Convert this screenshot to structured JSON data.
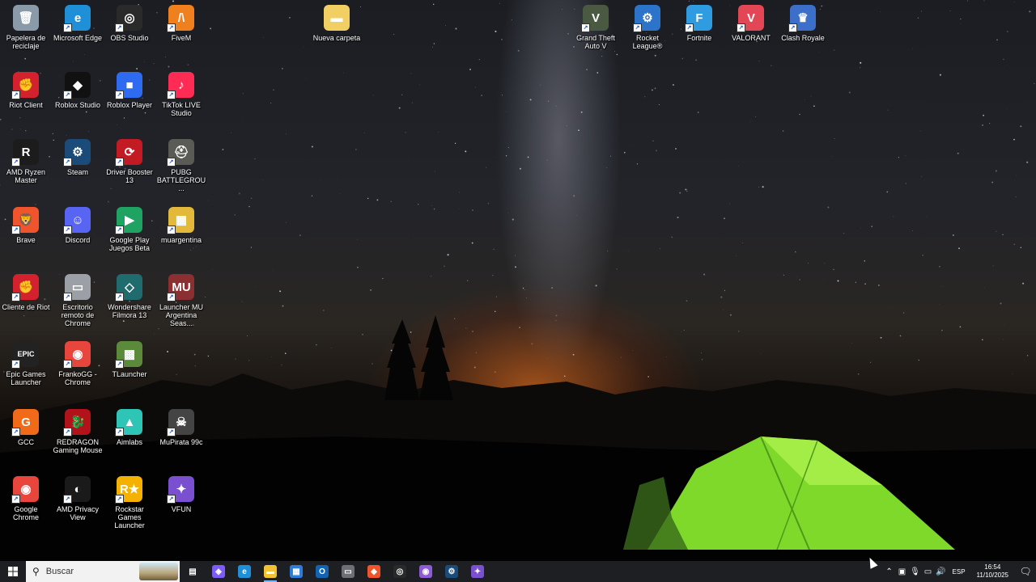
{
  "desktop": {
    "icons": [
      {
        "label": "Papelera de reciclaje",
        "glyph": "🗑",
        "color": "#8a9aa8",
        "shortcut": false
      },
      {
        "label": "Microsoft Edge",
        "glyph": "e",
        "color": "#1f8fd8",
        "shortcut": true
      },
      {
        "label": "OBS Studio",
        "glyph": "◎",
        "color": "#2a2a2a",
        "shortcut": true
      },
      {
        "label": "FiveM",
        "glyph": "/\\",
        "color": "#f0801e",
        "shortcut": true
      },
      {
        "label": "Nueva carpeta",
        "glyph": "▬",
        "color": "#f1cf62",
        "shortcut": false
      },
      {
        "label": "Grand Theft Auto V",
        "glyph": "V",
        "color": "#4a5a42",
        "shortcut": true
      },
      {
        "label": "Rocket League®",
        "glyph": "⚙",
        "color": "#2c74c9",
        "shortcut": true
      },
      {
        "label": "Fortnite",
        "glyph": "F",
        "color": "#2f9be0",
        "shortcut": true
      },
      {
        "label": "VALORANT",
        "glyph": "V",
        "color": "#e34655",
        "shortcut": true
      },
      {
        "label": "Clash Royale",
        "glyph": "♛",
        "color": "#3c6fc9",
        "shortcut": true
      },
      {
        "label": "Riot Client",
        "glyph": "✊",
        "color": "#d3222e",
        "shortcut": true
      },
      {
        "label": "Roblox Studio",
        "glyph": "◆",
        "color": "#111111",
        "shortcut": true
      },
      {
        "label": "Roblox Player",
        "glyph": "■",
        "color": "#2e6bf0",
        "shortcut": true
      },
      {
        "label": "TikTok LIVE Studio",
        "glyph": "♪",
        "color": "#fe2c55",
        "shortcut": true
      },
      {
        "label": "AMD Ryzen Master",
        "glyph": "R",
        "color": "#1c1c1c",
        "shortcut": true
      },
      {
        "label": "Steam",
        "glyph": "⚙",
        "color": "#1b4b78",
        "shortcut": true
      },
      {
        "label": "Driver Booster 13",
        "glyph": "⟳",
        "color": "#c21b24",
        "shortcut": true
      },
      {
        "label": "PUBG BATTLEGROU...",
        "glyph": "⛑",
        "color": "#5b5b55",
        "shortcut": true
      },
      {
        "label": "Brave",
        "glyph": "🦁",
        "color": "#f0542d",
        "shortcut": true
      },
      {
        "label": "Discord",
        "glyph": "☺",
        "color": "#5865f2",
        "shortcut": true
      },
      {
        "label": "Google Play Juegos Beta",
        "glyph": "▶",
        "color": "#1ea362",
        "shortcut": true
      },
      {
        "label": "muargentina",
        "glyph": "▦",
        "color": "#e2b93a",
        "shortcut": true
      },
      {
        "label": "Cliente de Riot",
        "glyph": "✊",
        "color": "#d3222e",
        "shortcut": true
      },
      {
        "label": "Escritorio remoto de Chrome",
        "glyph": "▭",
        "color": "#9aa0a6",
        "shortcut": true
      },
      {
        "label": "Wondershare Filmora 13",
        "glyph": "◇",
        "color": "#1f6b6e",
        "shortcut": true
      },
      {
        "label": "Launcher MU Argentina Seas...",
        "glyph": "MU",
        "color": "#8b2f32",
        "shortcut": true
      },
      {
        "label": "Epic Games Launcher",
        "glyph": "EPIC",
        "color": "#222222",
        "shortcut": true
      },
      {
        "label": "FrankoGG - Chrome",
        "glyph": "◉",
        "color": "#e8453c",
        "shortcut": true
      },
      {
        "label": "TLauncher",
        "glyph": "▩",
        "color": "#5a8a3a",
        "shortcut": true
      },
      {
        "label": "GCC",
        "glyph": "G",
        "color": "#f06a1a",
        "shortcut": true
      },
      {
        "label": "REDRAGON Gaming Mouse",
        "glyph": "🐉",
        "color": "#b2121a",
        "shortcut": true
      },
      {
        "label": "Aimlabs",
        "glyph": "▲",
        "color": "#2ec4b6",
        "shortcut": true
      },
      {
        "label": "MuPirata 99c",
        "glyph": "☠",
        "color": "#444444",
        "shortcut": true
      },
      {
        "label": "Google Chrome",
        "glyph": "◉",
        "color": "#e8453c",
        "shortcut": true
      },
      {
        "label": "AMD Privacy View",
        "glyph": "◐",
        "color": "#1a1a1a",
        "shortcut": true
      },
      {
        "label": "Rockstar Games Launcher",
        "glyph": "R★",
        "color": "#f5b100",
        "shortcut": true
      },
      {
        "label": "VFUN",
        "glyph": "✦",
        "color": "#7a4fd0",
        "shortcut": true
      }
    ]
  },
  "taskbar": {
    "start_icon": "windows-logo-icon",
    "search_placeholder": "Buscar",
    "pinned": [
      {
        "name": "task-view",
        "glyph": "▤",
        "color": "#1e1f22"
      },
      {
        "name": "copilot",
        "glyph": "◈",
        "color": "#7c5cf5"
      },
      {
        "name": "edge",
        "glyph": "e",
        "color": "#1f8fd8"
      },
      {
        "name": "file-explorer",
        "glyph": "▬",
        "color": "#f1c232",
        "active": true
      },
      {
        "name": "microsoft-store",
        "glyph": "▦",
        "color": "#2f7cd6"
      },
      {
        "name": "outlook",
        "glyph": "O",
        "color": "#1264b3"
      },
      {
        "name": "unknown-app",
        "glyph": "▭",
        "color": "#6c6f75"
      },
      {
        "name": "brave",
        "glyph": "◆",
        "color": "#f0542d"
      },
      {
        "name": "obs",
        "glyph": "◎",
        "color": "#2a2a2a"
      },
      {
        "name": "chrome-profile",
        "glyph": "◉",
        "color": "#8e5bd6"
      },
      {
        "name": "steam",
        "glyph": "⚙",
        "color": "#1b4b78"
      },
      {
        "name": "vfun",
        "glyph": "✦",
        "color": "#7a4fd0"
      }
    ],
    "tray": {
      "language": "ESP",
      "time": "16:54",
      "date": "11/10/2025"
    }
  }
}
